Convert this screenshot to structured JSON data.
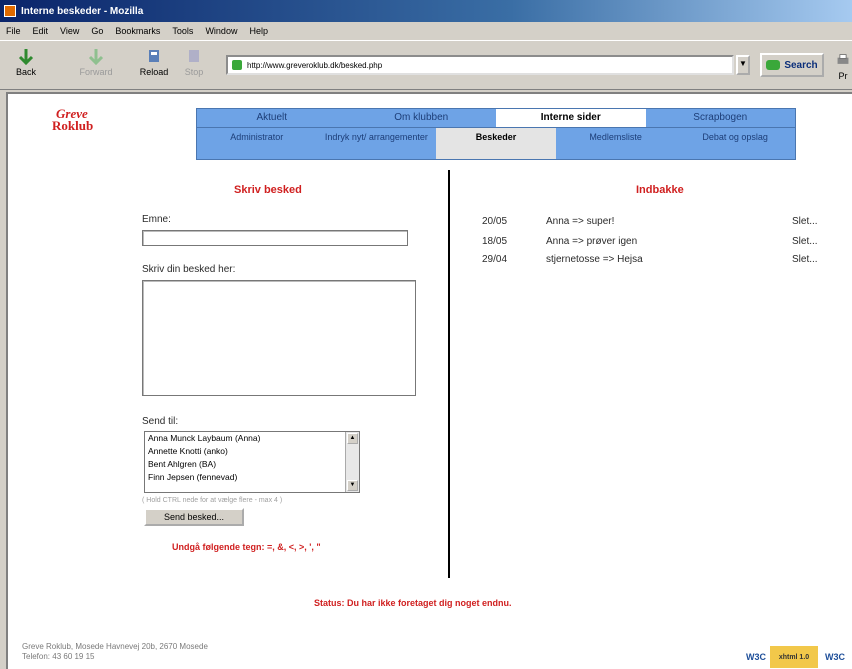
{
  "window": {
    "title": "Interne beskeder - Mozilla"
  },
  "menu": [
    "File",
    "Edit",
    "View",
    "Go",
    "Bookmarks",
    "Tools",
    "Window",
    "Help"
  ],
  "toolbar": {
    "back": "Back",
    "forward": "Forward",
    "reload": "Reload",
    "stop": "Stop",
    "url": "http://www.greveroklub.dk/besked.php",
    "search": "Search",
    "print": "Pr"
  },
  "site": {
    "logo_line1": "Greve",
    "logo_line2": "Roklub",
    "nav_top": [
      "Aktuelt",
      "Om klubben",
      "Interne sider",
      "Scrapbogen"
    ],
    "nav_sub": [
      "Administrator",
      "Indryk nyt/ arrangementer",
      "Beskeder",
      "Medlemsliste",
      "Debat og opslag"
    ]
  },
  "compose": {
    "heading": "Skriv besked",
    "subject_label": "Emne:",
    "subject_value": "",
    "message_label": "Skriv din besked her:",
    "message_value": "",
    "send_to_label": "Send til:",
    "recipients": [
      "Anna Munck Laybaum (Anna)",
      "Annette Knotti (anko)",
      "Bent Ahlgren (BA)",
      "Finn Jepsen (fennevad)"
    ],
    "hint": "( Hold CTRL nede for at vælge flere - max 4 )",
    "send_button": "Send besked...",
    "warning": "Undgå følgende tegn: =, &, <, >, ', \""
  },
  "inbox": {
    "heading": "Indbakke",
    "messages": [
      {
        "date": "20/05",
        "subject": "Anna => super!",
        "action": "Slet..."
      },
      {
        "date": "18/05",
        "subject": "Anna => prøver igen",
        "action": "Slet..."
      },
      {
        "date": "29/04",
        "subject": "stjernetosse => Hejsa",
        "action": "Slet..."
      }
    ]
  },
  "status": "Status: Du har ikke foretaget dig noget endnu.",
  "footer": {
    "line1": "Greve Roklub, Mosede Havnevej 20b, 2670 Mosede",
    "line2": "Telefon: 43 60 19 15"
  },
  "badges": [
    "W3C",
    "xhtml 1.0",
    "W3C"
  ]
}
